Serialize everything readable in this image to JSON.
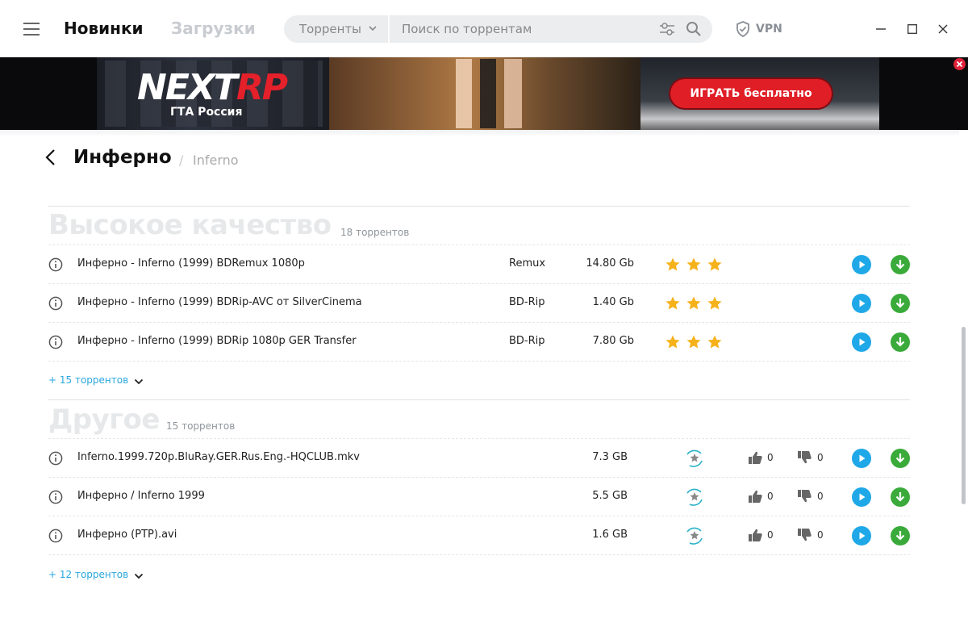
{
  "header": {
    "tabs": [
      {
        "label": "Новинки",
        "active": true
      },
      {
        "label": "Загрузки",
        "active": false
      }
    ],
    "search": {
      "category": "Торренты",
      "placeholder": "Поиск по торрентам"
    },
    "vpn_label": "VPN"
  },
  "ad_banner": {
    "logo_text_1": "NEXT",
    "logo_text_2": "RP",
    "logo_subtitle": "ГТА Россия",
    "cta_label": "ИГРАТЬ бесплатно"
  },
  "page": {
    "title": "Инферно",
    "separator": "/",
    "original_title": "Inferno"
  },
  "sections": [
    {
      "title": "Высокое качество",
      "count": "18 торрентов",
      "rows": [
        {
          "name": "Инферно - Inferno (1999) BDRemux 1080p",
          "type": "Remux",
          "size": "14.80 Gb",
          "stars": 3
        },
        {
          "name": "Инферно - Inferno (1999) BDRip-AVC от SilverCinema",
          "type": "BD-Rip",
          "size": "1.40 Gb",
          "stars": 3
        },
        {
          "name": "Инферно - Inferno (1999) BDRip 1080p GER Transfer",
          "type": "BD-Rip",
          "size": "7.80 Gb",
          "stars": 3
        }
      ],
      "more_label": "+ 15 торрентов"
    },
    {
      "title": "Другое",
      "count": "15 торрентов",
      "rows": [
        {
          "name": "Inferno.1999.720p.BluRay.GER.Rus.Eng.-HQCLUB.mkv",
          "size": "7.3 GB",
          "likes": "0",
          "dislikes": "0"
        },
        {
          "name": "Инферно / Inferno 1999",
          "size": "5.5 GB",
          "likes": "0",
          "dislikes": "0"
        },
        {
          "name": "Инферно (PTP).avi",
          "size": "1.6 GB",
          "likes": "0",
          "dislikes": "0"
        }
      ],
      "more_label": "+ 12 торрентов"
    }
  ],
  "colors": {
    "accent_blue": "#1fa8e8",
    "download_green": "#3aaa3a",
    "star_gold": "#f5b21b",
    "link_blue": "#2aa7de",
    "ad_red": "#e01e26"
  }
}
